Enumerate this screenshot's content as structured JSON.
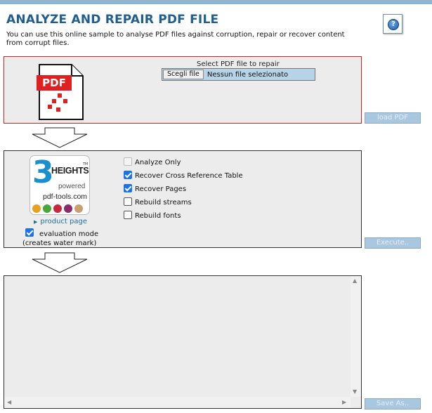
{
  "header": {
    "title": "ANALYZE AND REPAIR PDF FILE",
    "subtitle": "You can use this online sample to analyse PDF files against corruption, repair or recover content from corrupt files.",
    "help_icon": "?"
  },
  "upload": {
    "label": "Select PDF file to repair",
    "choose_button": "Scegli file",
    "file_status": "Nessun file selezionato",
    "pdf_icon_text": "PDF",
    "load_button": "load PDF"
  },
  "options": {
    "logo": {
      "digit": "3",
      "heights": "HEIGHTS",
      "tm": "TM",
      "powered": "powered",
      "brand": "pdf-tools.com",
      "dot_colors": [
        "#e8a020",
        "#4aa83a",
        "#c8283c",
        "#8a2a6a",
        "#c8a070"
      ]
    },
    "product_link": "product page",
    "items": [
      {
        "label": "Analyze Only",
        "checked": false,
        "disabled": true
      },
      {
        "label": "Recover Cross Reference Table",
        "checked": true,
        "disabled": false
      },
      {
        "label": "Recover Pages",
        "checked": true,
        "disabled": false
      },
      {
        "label": "Rebuild streams",
        "checked": false,
        "disabled": false
      },
      {
        "label": "Rebuild fonts",
        "checked": false,
        "disabled": false
      }
    ],
    "eval_label": "evaluation mode",
    "eval_note": "(creates water mark)",
    "eval_checked": true,
    "execute_button": "Execute.."
  },
  "output": {
    "content": "",
    "save_button": "Save As.."
  },
  "colors": {
    "title": "#1f5f8f",
    "accent_button": "#a9c7df",
    "upload_border": "#cc2222",
    "checkbox_on": "#1a73e8"
  }
}
